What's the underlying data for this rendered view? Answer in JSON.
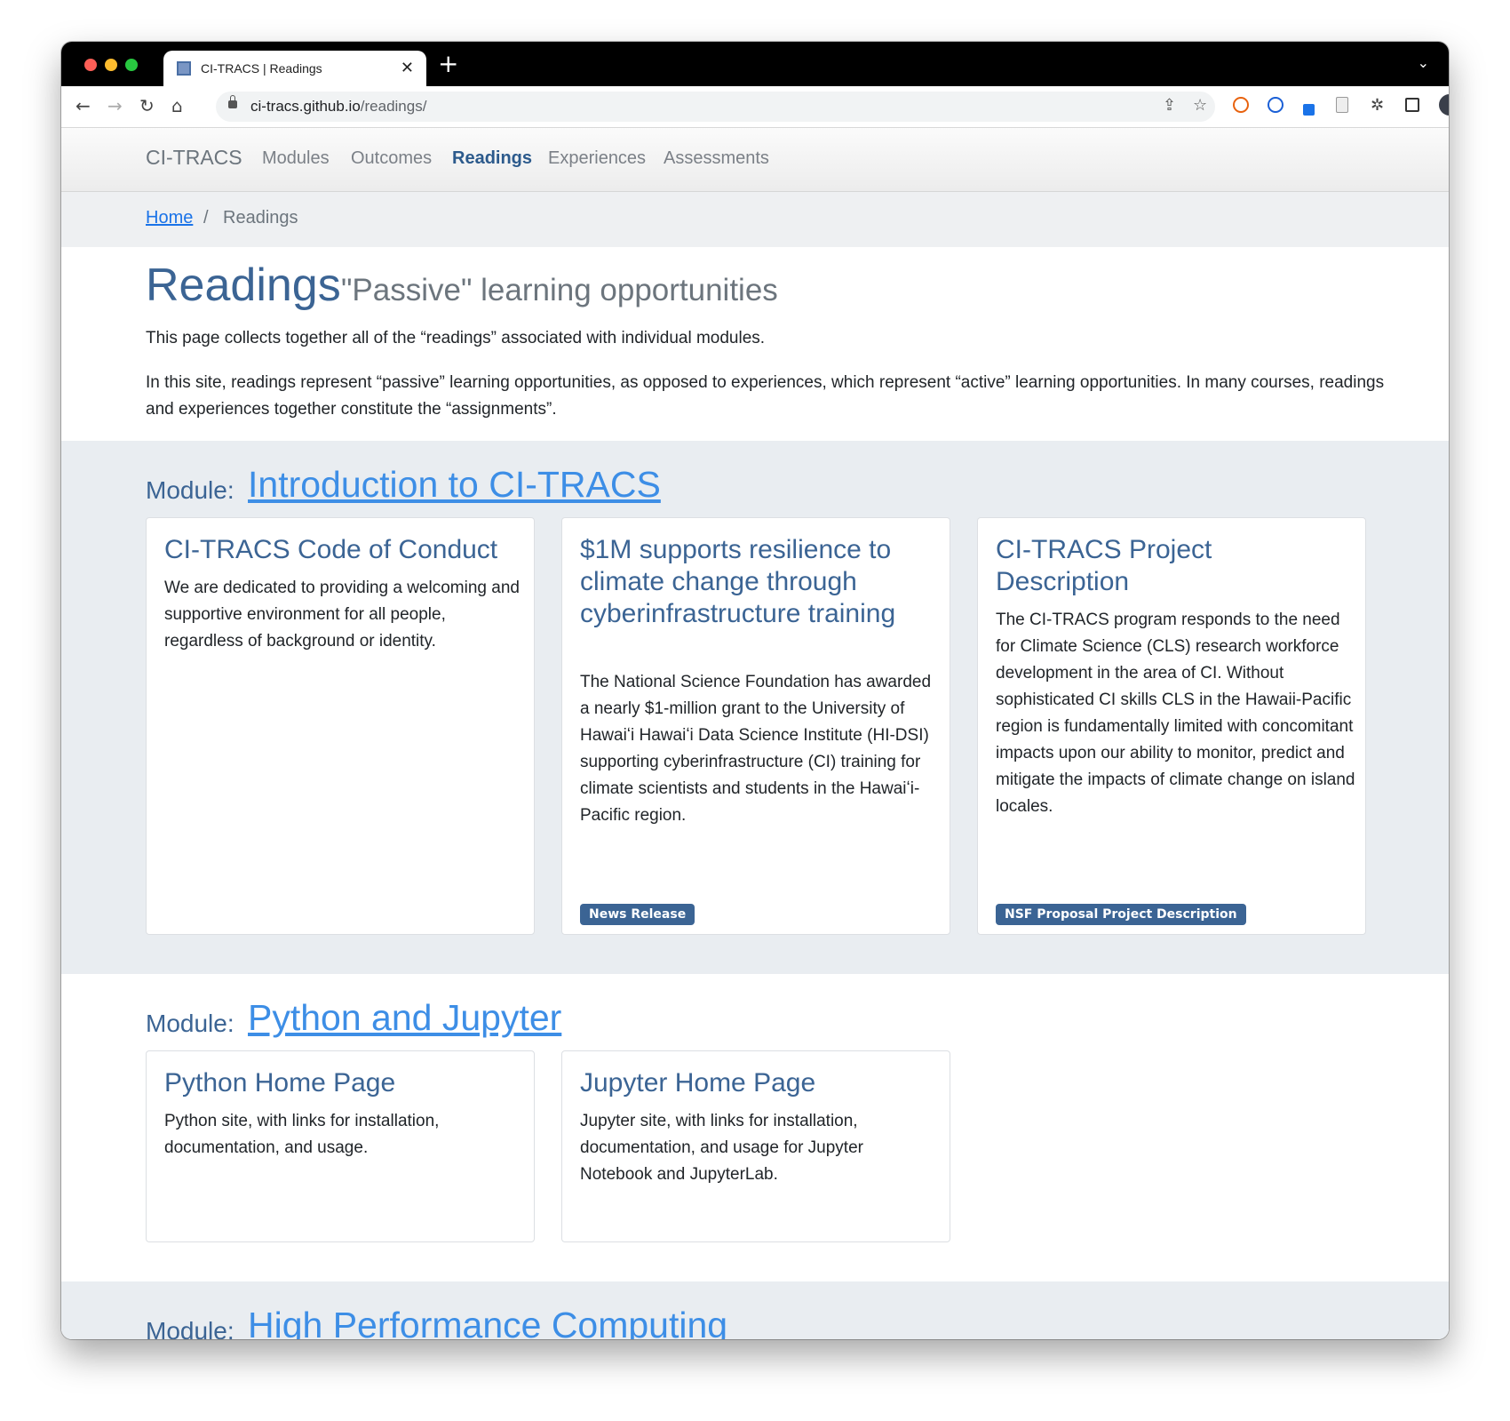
{
  "browser": {
    "tab_title": "CI-TRACS | Readings",
    "tab_close": "✕",
    "new_tab": "+",
    "url_domain": "ci-tracs.github.io",
    "url_path": "/readings/"
  },
  "nav": {
    "brand": "CI-TRACS",
    "links": [
      "Modules",
      "Outcomes",
      "Readings",
      "Experiences",
      "Assessments"
    ],
    "active": "Readings"
  },
  "breadcrumb": {
    "home": "Home",
    "separator": "/",
    "current": "Readings"
  },
  "header": {
    "title": "Readings",
    "subtitle": "\"Passive\" learning opportunities",
    "intro1": "This page collects together all of the “readings” associated with individual modules.",
    "intro2": "In this site, readings represent “passive” learning opportunities, as opposed to experiences, which represent “active” learning opportunities. In many courses, readings and experiences together constitute the “assignments”."
  },
  "modules": [
    {
      "label": "Module:",
      "name": "Introduction to CI-TRACS",
      "cards": [
        {
          "title": "CI-TRACS Code of Conduct",
          "text": "We are dedicated to providing a welcoming and supportive environment for all people, regardless of background or identity.",
          "badge": ""
        },
        {
          "title": "$1M supports resilience to climate change through cyberinfrastructure training",
          "text": "The National Science Foundation has awarded a nearly $1-million grant to the University of Hawaiʻi Hawaiʻi Data Science Institute (HI-DSI) supporting cyberinfrastructure (CI) training for climate scientists and students in the Hawaiʻi-Pacific region.",
          "badge": "News Release"
        },
        {
          "title": "CI-TRACS Project Description",
          "text": "The CI-TRACS program responds to the need for Climate Science (CLS) research workforce development in the area of CI. Without sophisticated CI skills CLS in the Hawaii-Pacific region is fundamentally limited with concomitant impacts upon our ability to monitor, predict and mitigate the impacts of climate change on island locales.",
          "badge": "NSF Proposal Project Description"
        }
      ]
    },
    {
      "label": "Module:",
      "name": "Python and Jupyter",
      "cards": [
        {
          "title": "Python Home Page",
          "text": "Python site, with links for installation, documentation, and usage.",
          "badge": ""
        },
        {
          "title": "Jupyter Home Page",
          "text": "Jupyter site, with links for installation, documentation, and usage for Jupyter Notebook and JupyterLab.",
          "badge": ""
        }
      ]
    },
    {
      "label": "Module:",
      "name": "High Performance Computing",
      "cards": []
    }
  ]
}
